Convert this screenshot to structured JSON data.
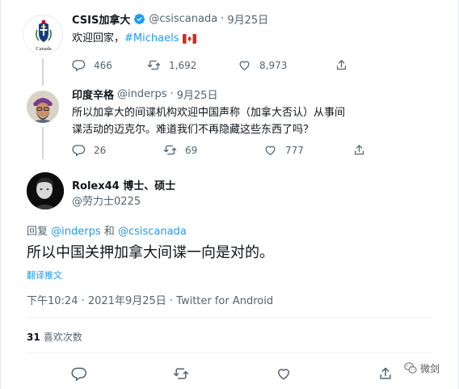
{
  "tweet1": {
    "name": "CSIS加拿大",
    "handle": "@csiscanada",
    "separator": "·",
    "date": "9月25日",
    "text_prefix": "欢迎回家，",
    "hashtag": "#Michaels",
    "logo_caption": "Canada",
    "replies": "466",
    "retweets": "1,692",
    "likes": "8,973"
  },
  "tweet2": {
    "name": "印度辛格",
    "handle": "@inderps",
    "separator": "·",
    "date": "9月25日",
    "text": "所以加拿大的间谍机构欢迎中国声称（加拿大否认）从事间谍活动的迈克尔。难道我们不再隐藏这些东西了吗？",
    "replies": "26",
    "retweets": "69",
    "likes": "777"
  },
  "main_tweet": {
    "name": "Rolex44 博士、硕士",
    "handle": "@劳力士0225",
    "reply_prefix": "回复",
    "reply_user1": "@inderps",
    "reply_join": "和",
    "reply_user2": "@csiscanada",
    "text": "所以中国关押加拿大间谍一向是对的。",
    "translate": "翻译推文",
    "meta": "下午10:24 · 2021年9月25日 · Twitter for Android",
    "likes_count": "31",
    "likes_label": "喜欢次数"
  },
  "watermark": {
    "text": "微剑"
  },
  "colors": {
    "accent": "#1d9bf0",
    "secondary_text": "#536471",
    "thread_line": "#cfd9de"
  },
  "icons": [
    "reply-icon",
    "retweet-icon",
    "like-icon",
    "share-icon",
    "verified-icon",
    "canada-flag-icon",
    "wechat-icon"
  ]
}
